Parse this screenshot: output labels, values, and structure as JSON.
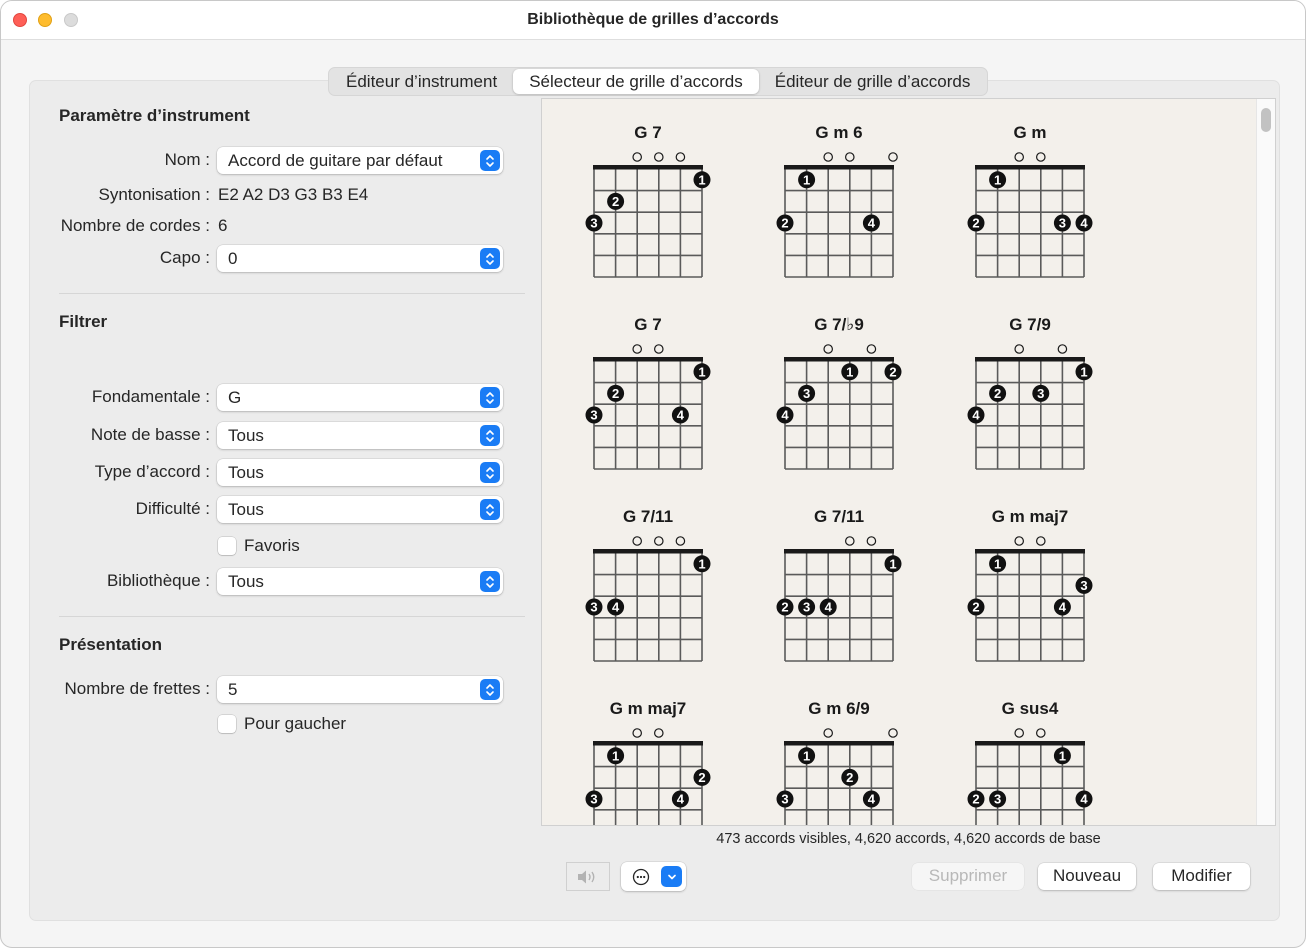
{
  "window": {
    "title": "Bibliothèque de grilles d’accords"
  },
  "tabs": [
    {
      "label": "Éditeur d’instrument",
      "active": false
    },
    {
      "label": "Sélecteur de grille d’accords",
      "active": true
    },
    {
      "label": "Éditeur de grille d’accords",
      "active": false
    }
  ],
  "instrument": {
    "heading": "Paramètre d’instrument",
    "name_label": "Nom :",
    "name_value": "Accord de guitare par défaut",
    "tuning_label": "Syntonisation :",
    "tuning_value": "E2 A2 D3 G3 B3 E4",
    "strings_label": "Nombre de cordes :",
    "strings_value": "6",
    "capo_label": "Capo :",
    "capo_value": "0"
  },
  "filter": {
    "heading": "Filtrer",
    "root_label": "Fondamentale :",
    "root_value": "G",
    "bass_label": "Note de basse :",
    "bass_value": "Tous",
    "type_label": "Type d’accord :",
    "type_value": "Tous",
    "difficulty_label": "Difficulté :",
    "difficulty_value": "Tous",
    "favorites_label": "Favoris",
    "favorites_checked": false,
    "library_label": "Bibliothèque :",
    "library_value": "Tous"
  },
  "presentation": {
    "heading": "Présentation",
    "frets_label": "Nombre de frettes :",
    "frets_value": "5",
    "lefthanded_label": "Pour gaucher",
    "lefthanded_checked": false
  },
  "chords": [
    {
      "name": "G 7",
      "open": [
        3,
        4,
        5
      ],
      "fingers": [
        {
          "s": 1,
          "f": 3,
          "n": 3
        },
        {
          "s": 2,
          "f": 2,
          "n": 2
        },
        {
          "s": 6,
          "f": 1,
          "n": 1
        }
      ]
    },
    {
      "name": "G m 6",
      "open": [
        3,
        4,
        6
      ],
      "fingers": [
        {
          "s": 1,
          "f": 3,
          "n": 2
        },
        {
          "s": 2,
          "f": 1,
          "n": 1
        },
        {
          "s": 5,
          "f": 3,
          "n": 4
        }
      ]
    },
    {
      "name": "G m",
      "open": [
        3,
        4
      ],
      "fingers": [
        {
          "s": 1,
          "f": 3,
          "n": 2
        },
        {
          "s": 2,
          "f": 1,
          "n": 1
        },
        {
          "s": 5,
          "f": 3,
          "n": 3
        },
        {
          "s": 6,
          "f": 3,
          "n": 4
        }
      ]
    },
    {
      "name": "G 7",
      "open": [
        3,
        4
      ],
      "fingers": [
        {
          "s": 1,
          "f": 3,
          "n": 3
        },
        {
          "s": 2,
          "f": 2,
          "n": 2
        },
        {
          "s": 5,
          "f": 3,
          "n": 4
        },
        {
          "s": 6,
          "f": 1,
          "n": 1
        }
      ]
    },
    {
      "name": "G 7/♭9",
      "open": [
        3,
        5
      ],
      "fingers": [
        {
          "s": 1,
          "f": 3,
          "n": 4
        },
        {
          "s": 2,
          "f": 2,
          "n": 3
        },
        {
          "s": 4,
          "f": 1,
          "n": 1
        },
        {
          "s": 6,
          "f": 1,
          "n": 2
        }
      ]
    },
    {
      "name": "G 7/9",
      "open": [
        3,
        5
      ],
      "fingers": [
        {
          "s": 1,
          "f": 3,
          "n": 4
        },
        {
          "s": 2,
          "f": 2,
          "n": 2
        },
        {
          "s": 4,
          "f": 2,
          "n": 3
        },
        {
          "s": 6,
          "f": 1,
          "n": 1
        }
      ]
    },
    {
      "name": "G 7/11",
      "open": [
        3,
        4,
        5
      ],
      "fingers": [
        {
          "s": 1,
          "f": 3,
          "n": 3
        },
        {
          "s": 2,
          "f": 3,
          "n": 4
        },
        {
          "s": 6,
          "f": 1,
          "n": 1
        }
      ]
    },
    {
      "name": "G 7/11",
      "open": [
        4,
        5
      ],
      "fingers": [
        {
          "s": 1,
          "f": 3,
          "n": 2
        },
        {
          "s": 2,
          "f": 3,
          "n": 3
        },
        {
          "s": 3,
          "f": 3,
          "n": 4
        },
        {
          "s": 6,
          "f": 1,
          "n": 1
        }
      ]
    },
    {
      "name": "G m maj7",
      "open": [
        3,
        4
      ],
      "fingers": [
        {
          "s": 1,
          "f": 3,
          "n": 2
        },
        {
          "s": 2,
          "f": 1,
          "n": 1
        },
        {
          "s": 5,
          "f": 3,
          "n": 4
        },
        {
          "s": 6,
          "f": 2,
          "n": 3
        }
      ]
    },
    {
      "name": "G m maj7",
      "open": [
        3,
        4
      ],
      "fingers": [
        {
          "s": 1,
          "f": 3,
          "n": 3
        },
        {
          "s": 2,
          "f": 1,
          "n": 1
        },
        {
          "s": 5,
          "f": 3,
          "n": 4
        },
        {
          "s": 6,
          "f": 2,
          "n": 2
        }
      ]
    },
    {
      "name": "G m 6/9",
      "open": [
        3,
        6
      ],
      "fingers": [
        {
          "s": 1,
          "f": 3,
          "n": 3
        },
        {
          "s": 2,
          "f": 1,
          "n": 1
        },
        {
          "s": 4,
          "f": 2,
          "n": 2
        },
        {
          "s": 5,
          "f": 3,
          "n": 4
        }
      ]
    },
    {
      "name": "G sus4",
      "open": [
        3,
        4
      ],
      "fingers": [
        {
          "s": 1,
          "f": 3,
          "n": 2
        },
        {
          "s": 2,
          "f": 3,
          "n": 3
        },
        {
          "s": 5,
          "f": 1,
          "n": 1
        },
        {
          "s": 6,
          "f": 3,
          "n": 4
        }
      ]
    }
  ],
  "status": "473 accords visibles, 4,620 accords, 4,620 accords de base",
  "buttons": {
    "delete": "Supprimer",
    "new": "Nouveau",
    "edit": "Modifier"
  },
  "colors": {
    "accent": "#1a7cf5",
    "browser_bg": "#f3f0eb"
  }
}
